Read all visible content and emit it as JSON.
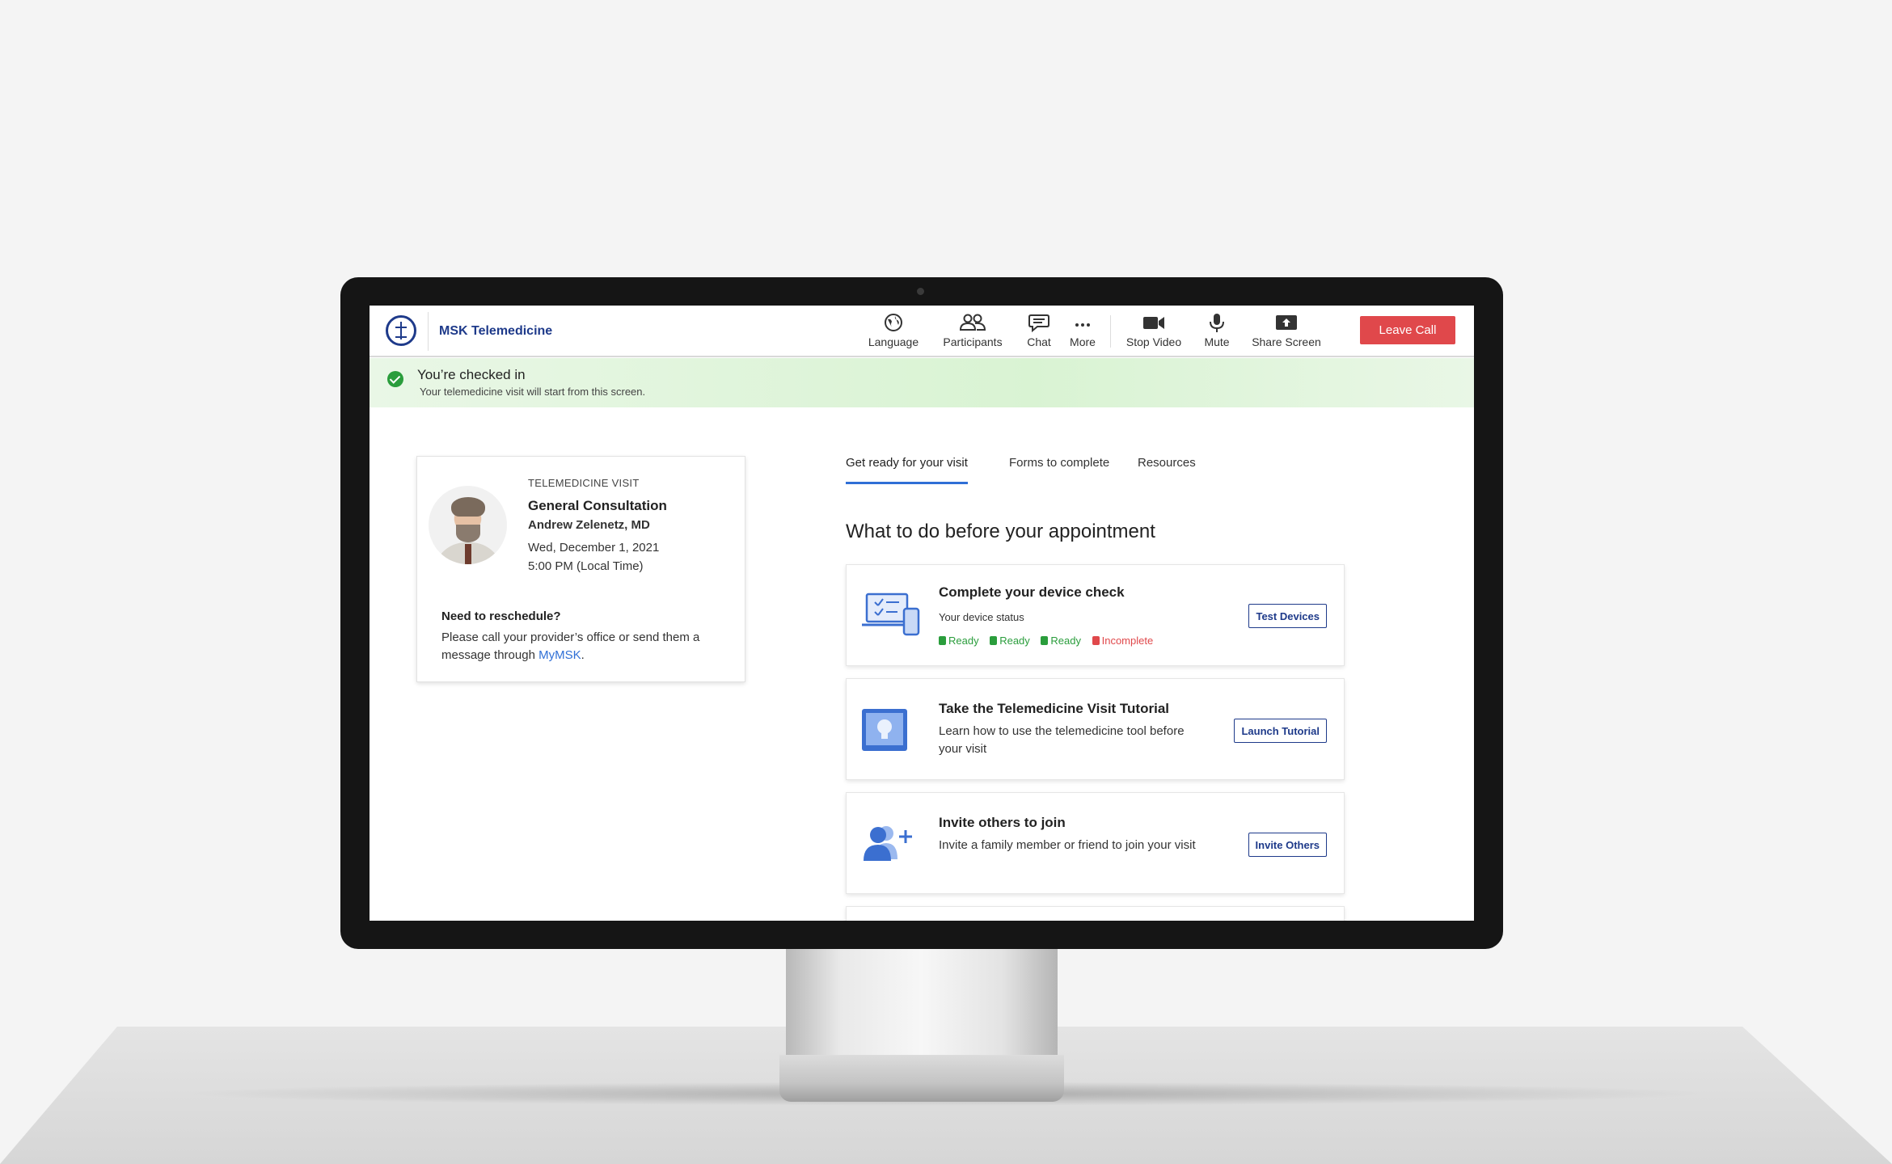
{
  "app": {
    "name": "MSK Telemedicine"
  },
  "toolbar": {
    "language": "Language",
    "participants": "Participants",
    "chat": "Chat",
    "more": "More",
    "stop_video": "Stop Video",
    "mute": "Mute",
    "share_screen": "Share Screen",
    "leave_call": "Leave Call"
  },
  "banner": {
    "title": "You’re checked in",
    "subtitle": "Your telemedicine visit will start from this screen."
  },
  "visit": {
    "label": "TELEMEDICINE VISIT",
    "title": "General Consultation",
    "doctor": "Andrew Zelenetz, MD",
    "date": "Wed, December 1, 2021",
    "time": "5:00 PM (Local Time)",
    "reschedule_title": "Need to reschedule?",
    "reschedule_text": "Please call your provider’s office or send them a message through ",
    "reschedule_link": "MyMSK",
    "reschedule_end": "."
  },
  "tabs": [
    {
      "label": "Get ready for your visit",
      "active": true
    },
    {
      "label": "Forms to complete",
      "active": false
    },
    {
      "label": "Resources",
      "active": false
    }
  ],
  "section_title": "What to do before your appointment",
  "tasks": {
    "device": {
      "title": "Complete your device check",
      "desc": "Your device status",
      "button": "Test Devices",
      "statuses": [
        {
          "label": "Ready",
          "state": "ready"
        },
        {
          "label": "Ready",
          "state": "ready"
        },
        {
          "label": "Ready",
          "state": "ready"
        },
        {
          "label": "Incomplete",
          "state": "incomplete"
        }
      ]
    },
    "tutorial": {
      "title": "Take the Telemedicine Visit Tutorial",
      "desc": "Learn how to use the telemedicine tool before your visit",
      "button": "Launch Tutorial"
    },
    "invite": {
      "title": "Invite others to join",
      "desc": "Invite a family member or friend to join your visit",
      "button": "Invite Others"
    }
  },
  "colors": {
    "brand": "#1e3a8a",
    "accent": "#2f6fd6",
    "leave": "#e0484b",
    "success": "#2a9d3c",
    "banner_bg": "#dff5da"
  },
  "icons": [
    "logo-icon",
    "globe-icon",
    "participants-icon",
    "chat-icon",
    "more-icon",
    "video-icon",
    "microphone-icon",
    "share-screen-icon",
    "checkmark-icon",
    "devices-icon",
    "lightbulb-icon",
    "add-user-icon"
  ]
}
